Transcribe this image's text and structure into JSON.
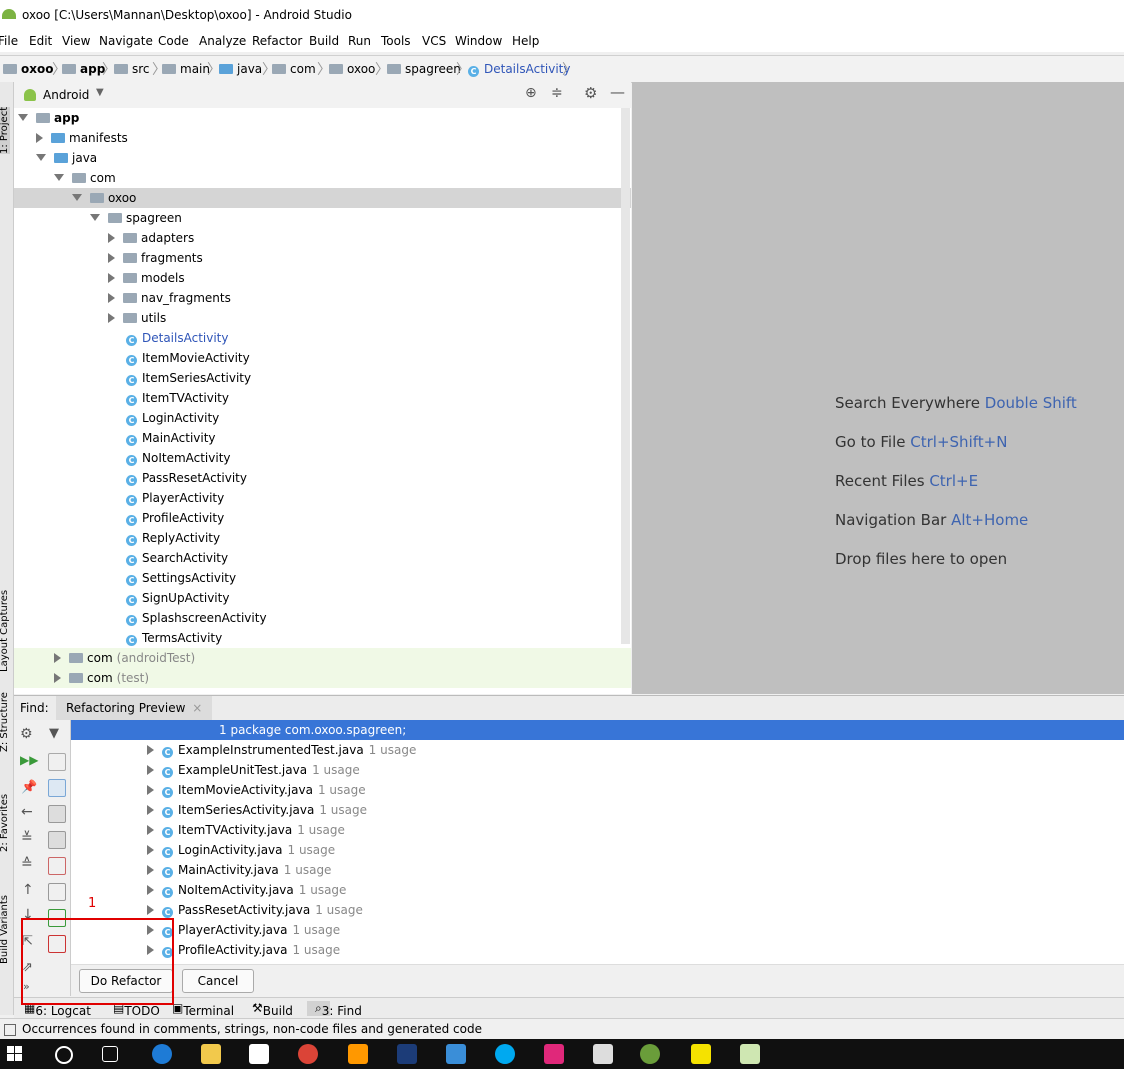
{
  "window": {
    "title": "oxoo [C:\\Users\\Mannan\\Desktop\\oxoo] - Android Studio"
  },
  "menu": [
    "File",
    "Edit",
    "View",
    "Navigate",
    "Code",
    "Analyze",
    "Refactor",
    "Build",
    "Run",
    "Tools",
    "VCS",
    "Window",
    "Help"
  ],
  "breadcrumb": [
    "oxoo",
    "app",
    "src",
    "main",
    "java",
    "com",
    "oxoo",
    "spagreen",
    "DetailsActivity"
  ],
  "project": {
    "view_selector": "Android",
    "tree": [
      {
        "label": "app",
        "depth": 0,
        "arrow": "d",
        "icon": "module",
        "bold": true
      },
      {
        "label": "manifests",
        "depth": 1,
        "arrow": "r",
        "icon": "folder-blue"
      },
      {
        "label": "java",
        "depth": 1,
        "arrow": "d",
        "icon": "folder-blue"
      },
      {
        "label": "com",
        "depth": 2,
        "arrow": "d",
        "icon": "package"
      },
      {
        "label": "oxoo",
        "depth": 3,
        "arrow": "d",
        "icon": "package",
        "selected": true
      },
      {
        "label": "spagreen",
        "depth": 4,
        "arrow": "d",
        "icon": "package"
      },
      {
        "label": "adapters",
        "depth": 5,
        "arrow": "r",
        "icon": "package"
      },
      {
        "label": "fragments",
        "depth": 5,
        "arrow": "r",
        "icon": "package"
      },
      {
        "label": "models",
        "depth": 5,
        "arrow": "r",
        "icon": "package"
      },
      {
        "label": "nav_fragments",
        "depth": 5,
        "arrow": "r",
        "icon": "package"
      },
      {
        "label": "utils",
        "depth": 5,
        "arrow": "r",
        "icon": "package"
      },
      {
        "label": "DetailsActivity",
        "depth": 5,
        "icon": "class",
        "blue": true
      },
      {
        "label": "ItemMovieActivity",
        "depth": 5,
        "icon": "class"
      },
      {
        "label": "ItemSeriesActivity",
        "depth": 5,
        "icon": "class"
      },
      {
        "label": "ItemTVActivity",
        "depth": 5,
        "icon": "class"
      },
      {
        "label": "LoginActivity",
        "depth": 5,
        "icon": "class"
      },
      {
        "label": "MainActivity",
        "depth": 5,
        "icon": "class"
      },
      {
        "label": "NoItemActivity",
        "depth": 5,
        "icon": "class"
      },
      {
        "label": "PassResetActivity",
        "depth": 5,
        "icon": "class"
      },
      {
        "label": "PlayerActivity",
        "depth": 5,
        "icon": "class"
      },
      {
        "label": "ProfileActivity",
        "depth": 5,
        "icon": "class"
      },
      {
        "label": "ReplyActivity",
        "depth": 5,
        "icon": "class"
      },
      {
        "label": "SearchActivity",
        "depth": 5,
        "icon": "class"
      },
      {
        "label": "SettingsActivity",
        "depth": 5,
        "icon": "class"
      },
      {
        "label": "SignUpActivity",
        "depth": 5,
        "icon": "class"
      },
      {
        "label": "SplashscreenActivity",
        "depth": 5,
        "icon": "class"
      },
      {
        "label": "TermsActivity",
        "depth": 5,
        "icon": "class"
      },
      {
        "label": "com",
        "suffix": "(androidTest)",
        "depth": 2,
        "arrow": "r",
        "icon": "package",
        "test": true
      },
      {
        "label": "com",
        "suffix": "(test)",
        "depth": 2,
        "arrow": "r",
        "icon": "package",
        "test": true
      }
    ]
  },
  "editor_hints": [
    {
      "text": "Search Everywhere",
      "key": "Double Shift"
    },
    {
      "text": "Go to File",
      "key": "Ctrl+Shift+N"
    },
    {
      "text": "Recent Files",
      "key": "Ctrl+E"
    },
    {
      "text": "Navigation Bar",
      "key": "Alt+Home"
    },
    {
      "text": "Drop files here to open",
      "key": ""
    }
  ],
  "find": {
    "label": "Find:",
    "tab": "Refactoring Preview",
    "header": "1 package com.oxoo.spagreen;",
    "results": [
      {
        "file": "ExampleInstrumentedTest.java",
        "usage": "1 usage"
      },
      {
        "file": "ExampleUnitTest.java",
        "usage": "1 usage"
      },
      {
        "file": "ItemMovieActivity.java",
        "usage": "1 usage"
      },
      {
        "file": "ItemSeriesActivity.java",
        "usage": "1 usage"
      },
      {
        "file": "ItemTVActivity.java",
        "usage": "1 usage"
      },
      {
        "file": "LoginActivity.java",
        "usage": "1 usage"
      },
      {
        "file": "MainActivity.java",
        "usage": "1 usage"
      },
      {
        "file": "NoItemActivity.java",
        "usage": "1 usage"
      },
      {
        "file": "PassResetActivity.java",
        "usage": "1 usage"
      },
      {
        "file": "PlayerActivity.java",
        "usage": "1 usage"
      },
      {
        "file": "ProfileActivity.java",
        "usage": "1 usage"
      }
    ],
    "do_refactor": "Do Refactor",
    "cancel": "Cancel"
  },
  "annotation": "1",
  "side_tabs": [
    "1: Project",
    "Layout Captures",
    "Z: Structure",
    "2: Favorites",
    "Build Variants"
  ],
  "tool_windows": [
    "6: Logcat",
    "TODO",
    "Terminal",
    "Build",
    "3: Find"
  ],
  "status": "Occurrences found in comments, strings, non-code files and generated code"
}
